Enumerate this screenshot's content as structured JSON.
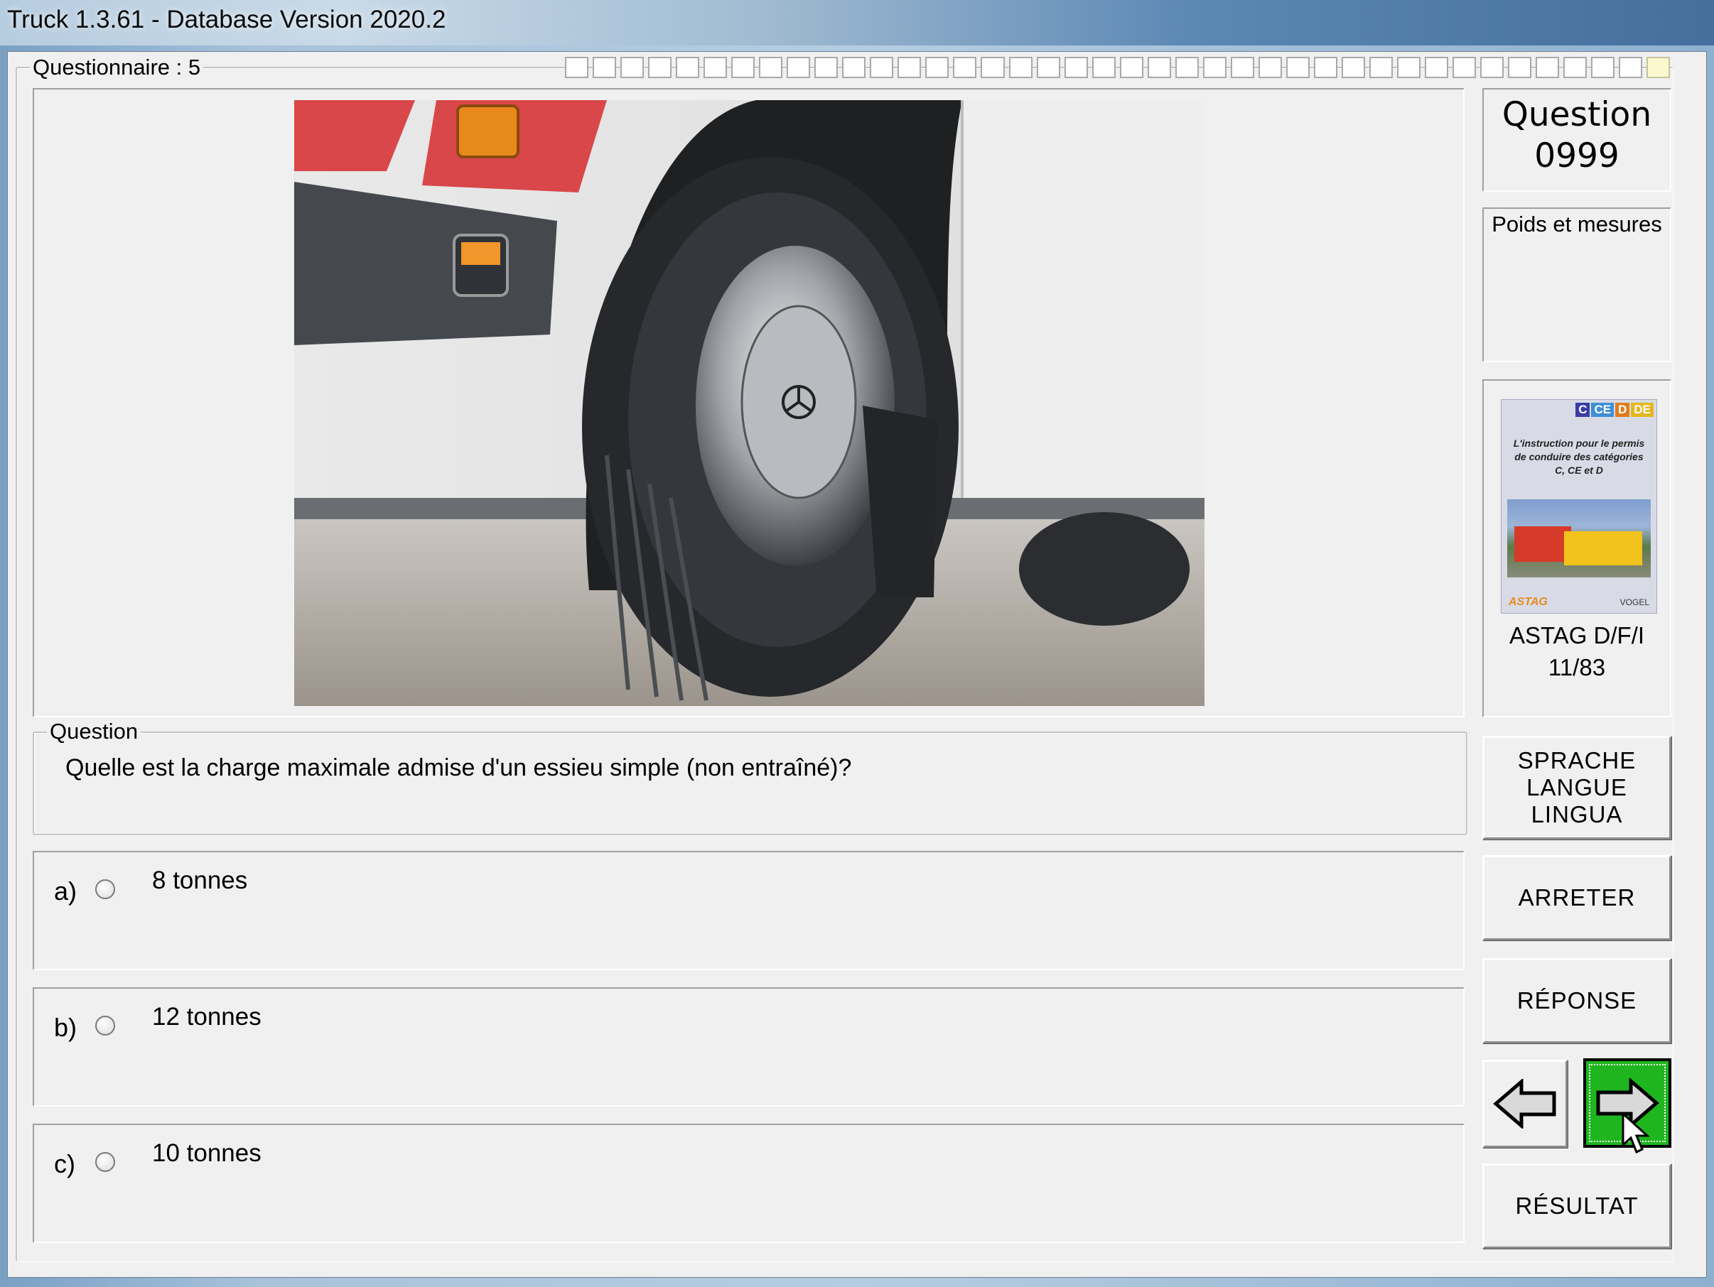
{
  "window": {
    "title": "Truck 1.3.61 - Database Version 2020.2"
  },
  "questionnaire": {
    "legend": "Questionnaire : 5",
    "progress_total": 40,
    "progress_done": 1
  },
  "question_panel": {
    "number_label": "Question",
    "number": "0999",
    "category": "Poids et mesures"
  },
  "book": {
    "cover_tags": [
      "C",
      "CE",
      "D",
      "DE"
    ],
    "cover_text": "L'instruction pour le permis de conduire des catégories C, CE et D",
    "cover_brand_left": "ASTAG",
    "cover_brand_right": "VOGEL",
    "reference": "ASTAG D/F/I",
    "page": "11/83"
  },
  "question": {
    "legend": "Question",
    "text": "Quelle est la charge maximale admise d'un essieu simple (non entraîné)?"
  },
  "answers": [
    {
      "letter": "a)",
      "text": "8 tonnes"
    },
    {
      "letter": "b)",
      "text": "12 tonnes"
    },
    {
      "letter": "c)",
      "text": "10 tonnes"
    }
  ],
  "buttons": {
    "language_1": "SPRACHE",
    "language_2": "LANGUE",
    "language_3": "LINGUA",
    "stop": "ARRETER",
    "answer": "RÉPONSE",
    "result": "RÉSULTAT",
    "prev_icon": "arrow-left-icon",
    "next_icon": "arrow-right-icon"
  },
  "colors": {
    "next_button": "#1fb51f",
    "accent_orange": "#e8891c",
    "bus_red": "#d9474a"
  }
}
